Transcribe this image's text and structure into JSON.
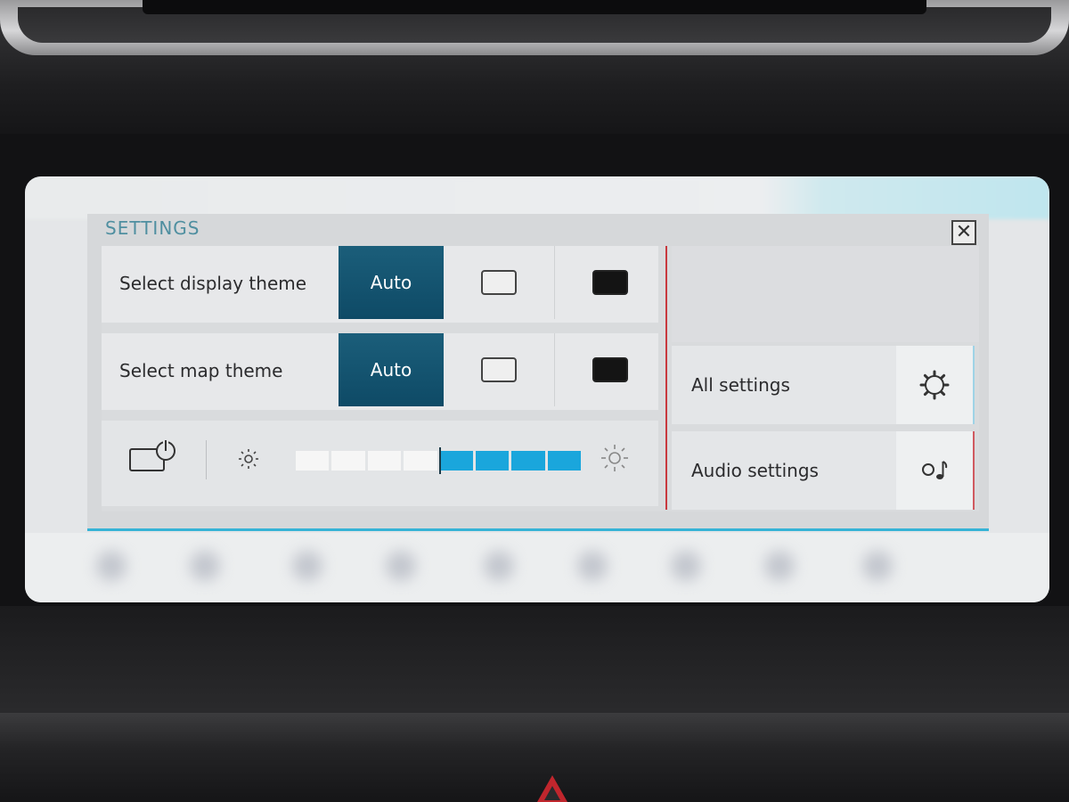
{
  "settings": {
    "title": "SETTINGS",
    "close_label": "✕",
    "display_theme": {
      "label": "Select display theme",
      "options": [
        "Auto",
        "light",
        "dark"
      ],
      "selected_label": "Auto"
    },
    "map_theme": {
      "label": "Select map theme",
      "options": [
        "Auto",
        "light",
        "dark"
      ],
      "selected_label": "Auto"
    },
    "brightness": {
      "segments_total": 8,
      "level": 4
    },
    "side_menu": {
      "all_settings_label": "All settings",
      "audio_settings_label": "Audio settings"
    }
  },
  "icons": {
    "screen_off": "screen-power-icon",
    "brightness_low": "sun-small-icon",
    "brightness_high": "sun-large-icon",
    "all_settings": "gear-icon",
    "audio_settings": "music-note-icon",
    "close": "close-icon"
  },
  "colors": {
    "accent": "#1aa6dc",
    "selected_option": "#0e4a66",
    "title_text": "#4f8fa0",
    "divider_red": "#c8393f"
  }
}
